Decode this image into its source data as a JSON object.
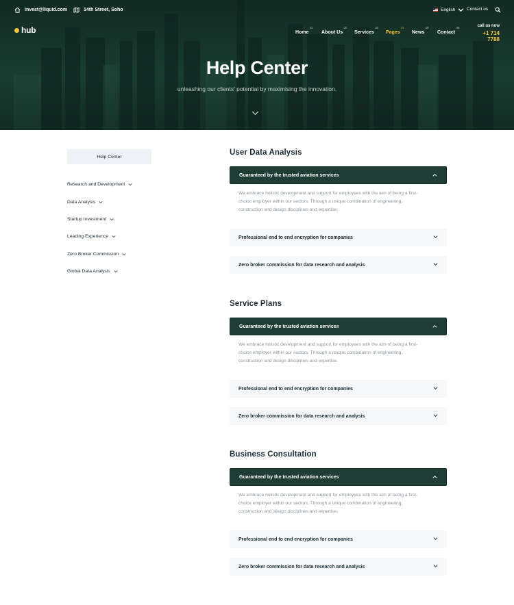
{
  "topbar": {
    "email": "invest@liquid.com",
    "address": "14th Street, Soho",
    "language": "English",
    "contact_link": "Contact us"
  },
  "logo": {
    "text": "hub"
  },
  "nav": {
    "items": [
      {
        "label": "Home",
        "num": "01"
      },
      {
        "label": "About Us",
        "num": "02"
      },
      {
        "label": "Services",
        "num": "03"
      },
      {
        "label": "Pages",
        "num": "04"
      },
      {
        "label": "News",
        "num": "05"
      },
      {
        "label": "Contact",
        "num": "06"
      }
    ],
    "active": "Pages"
  },
  "call": {
    "label": "call us now",
    "number": "+1 714 7788"
  },
  "hero": {
    "title": "Help Center",
    "subtitle": "unleashing our clients' potential by maximising the innovation."
  },
  "sidebar": {
    "header": "Help Center",
    "items": [
      "Research and Development",
      "Data Analysis",
      "Startup Investment",
      "Leading Experience",
      "Zero Broker Commission",
      "Global Data Analysis"
    ]
  },
  "sections": [
    {
      "title": "User Data Analysis",
      "open_item": {
        "title": "Guaranteed by the trusted aviation services",
        "body_lines": [
          "We embrace holistic development and support for employees with the aim of being a first-",
          "choice employer within our sectors. Through a unique combination of engineering,",
          "construction and design disciplines and expertise."
        ]
      },
      "closed_items": [
        "Professional end to end encryption for companies",
        "Zero broker commission for data research and analysis"
      ]
    },
    {
      "title": "Service Plans",
      "open_item": {
        "title": "Guaranteed by the trusted aviation services",
        "body_lines": [
          "We embrace holistic development and support for employees with the aim of being a first-",
          "choice employer within our sectors. Through a unique combination of engineering,",
          "construction and design disciplines and expertise."
        ]
      },
      "closed_items": [
        "Professional end to end encryption for companies",
        "Zero broker commission for data research and analysis"
      ]
    },
    {
      "title": "Business Consultation",
      "open_item": {
        "title": "Guaranteed by the trusted aviation services",
        "body_lines": [
          "We embrace holistic development and support for employees with the aim of being a first-",
          "choice employer within our sectors. Through a unique combination of engineering,",
          "construction and design disciplines and expertise."
        ]
      },
      "closed_items": [
        "Professional end to end encryption for companies",
        "Zero broker commission for data research and analysis"
      ]
    }
  ],
  "colors": {
    "hero_bg": "#1e4236",
    "accent": "#f5c440",
    "accordion_open": "#1f3d35",
    "accordion_closed": "#f5f7f9",
    "sidebar_box": "#eef1f5"
  },
  "icons": [
    "home-icon",
    "map-icon",
    "search-icon",
    "chevron-down-icon",
    "chevron-up-icon"
  ]
}
